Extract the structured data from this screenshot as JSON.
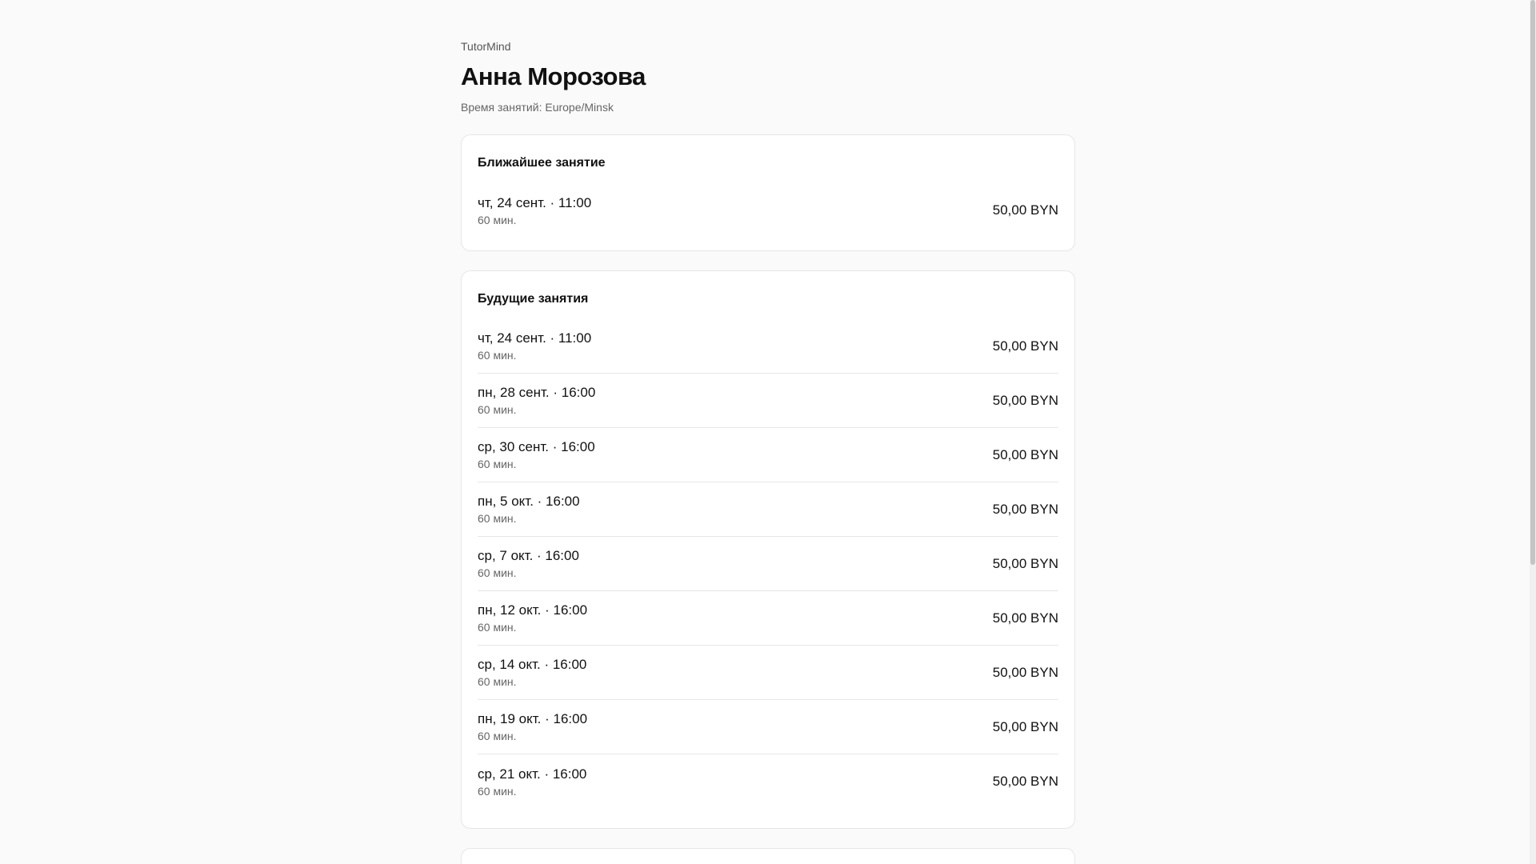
{
  "header": {
    "brand": "TutorMind",
    "student_name": "Анна Морозова",
    "timezone_line": "Время занятий: Europe/Minsk"
  },
  "next_lesson": {
    "heading": "Ближайшее занятие",
    "date": "чт, 24 сент. · 11:00",
    "duration": "60 мин.",
    "price": "50,00 BYN"
  },
  "upcoming": {
    "heading": "Будущие занятия",
    "items": [
      {
        "date": "чт, 24 сент. · 11:00",
        "duration": "60 мин.",
        "price": "50,00 BYN"
      },
      {
        "date": "пн, 28 сент. · 16:00",
        "duration": "60 мин.",
        "price": "50,00 BYN"
      },
      {
        "date": "ср, 30 сент. · 16:00",
        "duration": "60 мин.",
        "price": "50,00 BYN"
      },
      {
        "date": "пн, 5 окт. · 16:00",
        "duration": "60 мин.",
        "price": "50,00 BYN"
      },
      {
        "date": "ср, 7 окт. · 16:00",
        "duration": "60 мин.",
        "price": "50,00 BYN"
      },
      {
        "date": "пн, 12 окт. · 16:00",
        "duration": "60 мин.",
        "price": "50,00 BYN"
      },
      {
        "date": "ср, 14 окт. · 16:00",
        "duration": "60 мин.",
        "price": "50,00 BYN"
      },
      {
        "date": "пн, 19 окт. · 16:00",
        "duration": "60 мин.",
        "price": "50,00 BYN"
      },
      {
        "date": "ср, 21 окт. · 16:00",
        "duration": "60 мин.",
        "price": "50,00 BYN"
      }
    ]
  }
}
